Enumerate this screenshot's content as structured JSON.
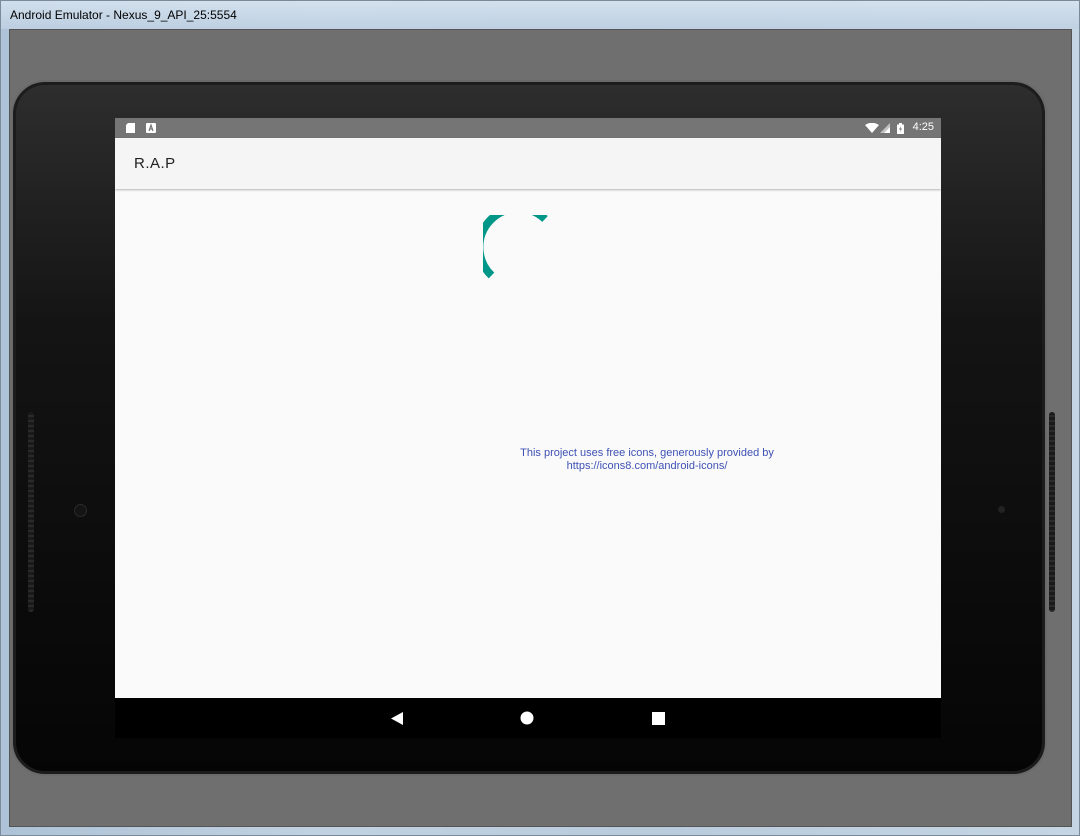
{
  "window": {
    "title": "Android Emulator - Nexus_9_API_25:5554"
  },
  "status_bar": {
    "time": "4:25",
    "icons": [
      "sd-card-icon",
      "a-notification-icon",
      "wifi-icon",
      "cell-signal-icon",
      "battery-icon"
    ]
  },
  "app_bar": {
    "title": "R.A.P"
  },
  "loading": {
    "spinner_color": "#009688"
  },
  "credit": {
    "line1": "This project uses free icons, generously provided by",
    "line2": "https://icons8.com/android-icons/"
  },
  "nav_bar": {
    "buttons": [
      "back-icon",
      "home-icon",
      "recents-icon"
    ]
  },
  "colors": {
    "status_bar": "#757575",
    "app_bar": "#f5f5f5",
    "screen_bg": "#fafafa",
    "credit_text": "#3f51b5",
    "accent": "#009688"
  }
}
